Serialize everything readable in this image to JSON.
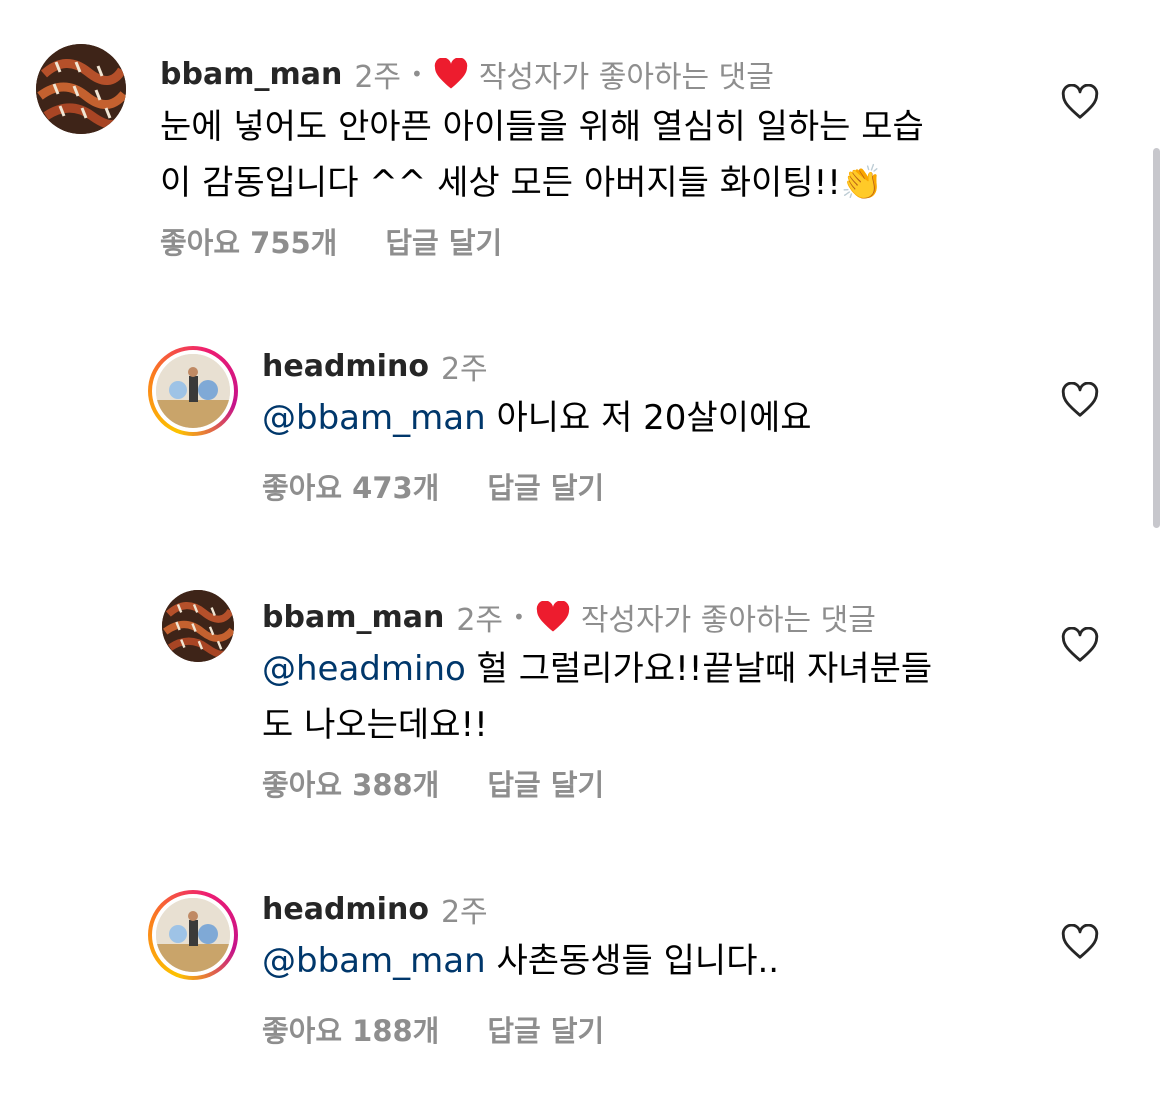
{
  "comments": [
    {
      "username": "bbam_man",
      "time": "2주",
      "separator": "•",
      "author_liked_text": "작성자가 좋아하는 댓글",
      "mention": "",
      "text_line1": "눈에 넣어도 안아픈 아이들을 위해 열심히 일하는 모습",
      "text_line2": "이 감동입니다 ^^ 세상 모든 아버지들 화이팅!!",
      "emoji": "👏",
      "likes": "좋아요 755개",
      "reply": "답글 달기"
    },
    {
      "username": "headmino",
      "time": "2주",
      "mention": "@bbam_man",
      "text": "아니요 저 20살이에요",
      "likes": "좋아요 473개",
      "reply": "답글 달기"
    },
    {
      "username": "bbam_man",
      "time": "2주",
      "separator": "•",
      "author_liked_text": "작성자가 좋아하는 댓글",
      "mention": "@headmino",
      "text_line1": "헐 그럴리가요!!끝날때 자녀분들",
      "text_line2": "도 나오는데요!!",
      "likes": "좋아요 388개",
      "reply": "답글 달기"
    },
    {
      "username": "headmino",
      "time": "2주",
      "mention": "@bbam_man",
      "text": "사촌동생들 입니다..",
      "likes": "좋아요 188개",
      "reply": "답글 달기"
    }
  ],
  "colors": {
    "like_red": "#ed4956",
    "mention_blue": "#00376b",
    "meta_gray": "#8e8e8e"
  },
  "icons": [
    "heart-icon",
    "heart-outline-icon"
  ]
}
